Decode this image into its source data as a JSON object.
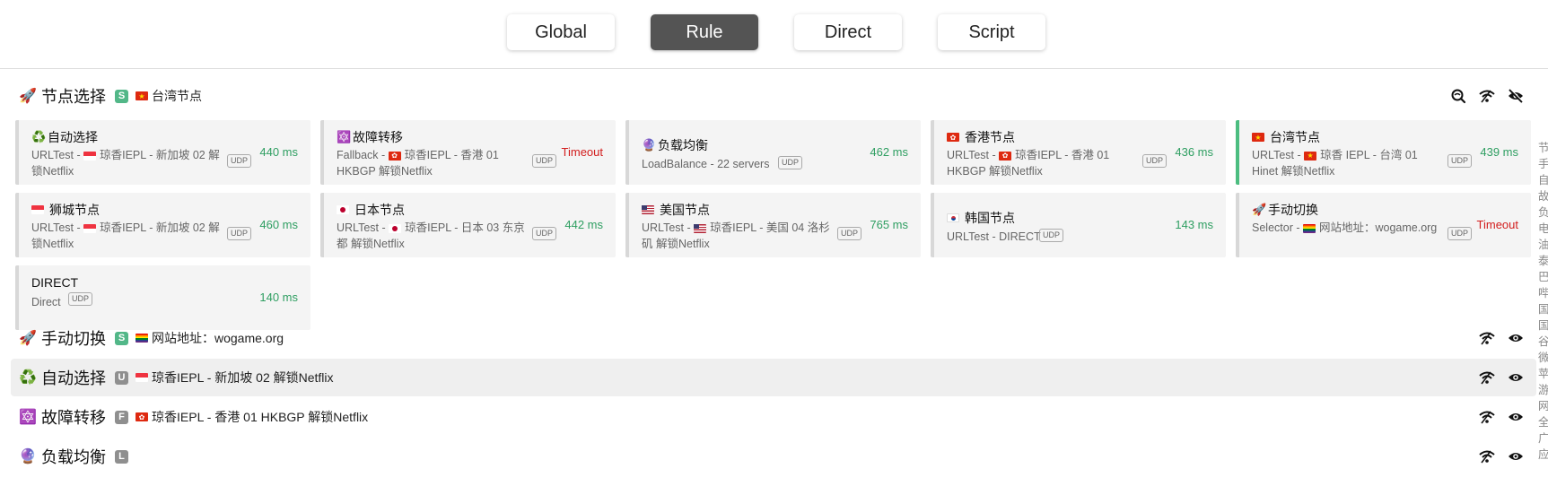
{
  "modes": [
    {
      "label": "Global",
      "active": false
    },
    {
      "label": "Rule",
      "active": true
    },
    {
      "label": "Direct",
      "active": false
    },
    {
      "label": "Script",
      "active": false
    }
  ],
  "groups": [
    {
      "icon": "🚀",
      "name": "节点选择",
      "type": "S",
      "now_flag": "cn",
      "now": "台湾节点"
    },
    {
      "icon": "🚀",
      "name": "手动切换",
      "type": "S",
      "now_flag": "rb",
      "now": "网站地址：wogame.org"
    },
    {
      "icon": "♻️",
      "name": "自动选择",
      "type": "U",
      "now_flag": "sg",
      "now": "琼香IEPL - 新加坡 02 解锁Netflix"
    },
    {
      "icon": "🔯",
      "name": "故障转移",
      "type": "F",
      "now_flag": "hk",
      "now": "琼香IEPL - 香港 01 HKBGP 解锁Netflix"
    },
    {
      "icon": "🔮",
      "name": "负载均衡",
      "type": "L",
      "now_flag": "",
      "now": ""
    }
  ],
  "cards": [
    {
      "icon": "♻️",
      "name": "自动选择",
      "desc_prefix": "URLTest - ",
      "desc_flag": "sg",
      "desc": "琼香IEPL - 新加坡 02 解锁Netflix",
      "udp": "UDP",
      "delay": "440 ms"
    },
    {
      "icon": "🔯",
      "name": "故障转移",
      "desc_prefix": "Fallback - ",
      "desc_flag": "hk",
      "desc": "琼香IEPL - 香港 01 HKBGP 解锁Netflix",
      "udp": "UDP",
      "delay": "Timeout"
    },
    {
      "icon": "🔮",
      "name": "负载均衡",
      "desc_prefix": "LoadBalance - 22 servers",
      "desc_flag": "",
      "desc": "",
      "udp": "UDP",
      "delay": "462 ms"
    },
    {
      "icon": "",
      "name": "香港节点",
      "name_flag": "hk",
      "desc_prefix": "URLTest - ",
      "desc_flag": "hk",
      "desc": "琼香IEPL - 香港 01 HKBGP 解锁Netflix",
      "udp": "UDP",
      "delay": "436 ms"
    },
    {
      "icon": "",
      "name": "台湾节点",
      "name_flag": "cn",
      "desc_prefix": "URLTest - ",
      "desc_flag": "cn",
      "desc": "琼香 IEPL - 台湾 01 Hinet 解锁Netflix",
      "udp": "UDP",
      "delay": "439 ms"
    },
    {
      "icon": "",
      "name": "狮城节点",
      "name_flag": "sg",
      "desc_prefix": "URLTest - ",
      "desc_flag": "sg",
      "desc": "琼香IEPL - 新加坡 02 解锁Netflix",
      "udp": "UDP",
      "delay": "460 ms"
    },
    {
      "icon": "",
      "name": "日本节点",
      "name_flag": "jp",
      "desc_prefix": "URLTest - ",
      "desc_flag": "jp",
      "desc": "琼香IEPL - 日本 03 东京都 解锁Netflix",
      "udp": "UDP",
      "delay": "442 ms"
    },
    {
      "icon": "",
      "name": "美国节点",
      "name_flag": "us",
      "desc_prefix": "URLTest - ",
      "desc_flag": "us",
      "desc": "琼香IEPL - 美国 04 洛杉矶 解锁Netflix",
      "udp": "UDP",
      "delay": "765 ms"
    },
    {
      "icon": "",
      "name": "韩国节点",
      "name_flag": "kr",
      "desc_prefix": "URLTest - DIRECT",
      "desc_flag": "",
      "desc": "",
      "udp": "UDP",
      "delay": "143 ms"
    },
    {
      "icon": "🚀",
      "name": "手动切换",
      "desc_prefix": "Selector - ",
      "desc_flag": "rb",
      "desc": "网站地址：wogame.org",
      "udp": "UDP",
      "delay": "Timeout"
    },
    {
      "icon": "",
      "name": "DIRECT",
      "desc_prefix": "Direct",
      "desc_flag": "",
      "desc": "",
      "udp": "UDP",
      "delay": "140 ms"
    }
  ],
  "side_column": [
    "节",
    "手",
    "自",
    "故",
    "负",
    "电",
    "油",
    "泰",
    "巴",
    "哔",
    "国",
    "国",
    "谷",
    "微",
    "苹",
    "游",
    "网",
    "全",
    "广",
    "应"
  ]
}
